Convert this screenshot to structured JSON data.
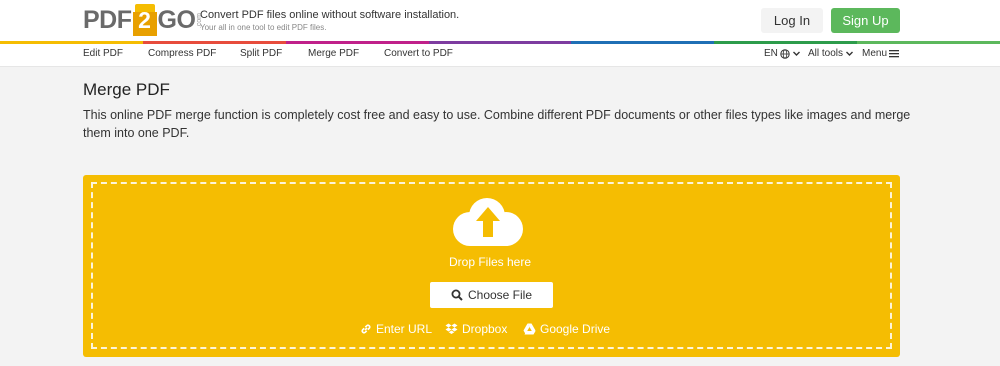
{
  "header": {
    "logo": {
      "part1": "PDF",
      "part2": "2",
      "part3": "GO",
      "suffix": ".com"
    },
    "tagline_main": "Convert PDF files online without software installation.",
    "tagline_sub": "Your all in one tool to edit PDF files.",
    "login_label": "Log In",
    "signup_label": "Sign Up"
  },
  "rainbow_colors": [
    "#f5bd02",
    "#e74c3c",
    "#c0208a",
    "#7d3ca0",
    "#1f6fb5",
    "#2d9c4b",
    "#5cb85c"
  ],
  "nav": {
    "items": [
      "Edit PDF",
      "Compress PDF",
      "Split PDF",
      "Merge PDF",
      "Convert to PDF"
    ],
    "language": "EN",
    "all_tools": "All tools",
    "menu": "Menu"
  },
  "main": {
    "title": "Merge PDF",
    "description": "This online PDF merge function is completely cost free and easy to use. Combine different PDF documents or other files types like images and merge them into one PDF."
  },
  "dropzone": {
    "drop_text": "Drop Files here",
    "choose_label": "Choose File",
    "sources": [
      "Enter URL",
      "Dropbox",
      "Google Drive"
    ],
    "accent_color": "#f5bd02"
  },
  "icons": [
    "upload-cloud-icon",
    "search-icon",
    "link-icon",
    "dropbox-icon",
    "google-drive-icon",
    "globe-icon",
    "chevron-down-icon",
    "hamburger-icon"
  ]
}
